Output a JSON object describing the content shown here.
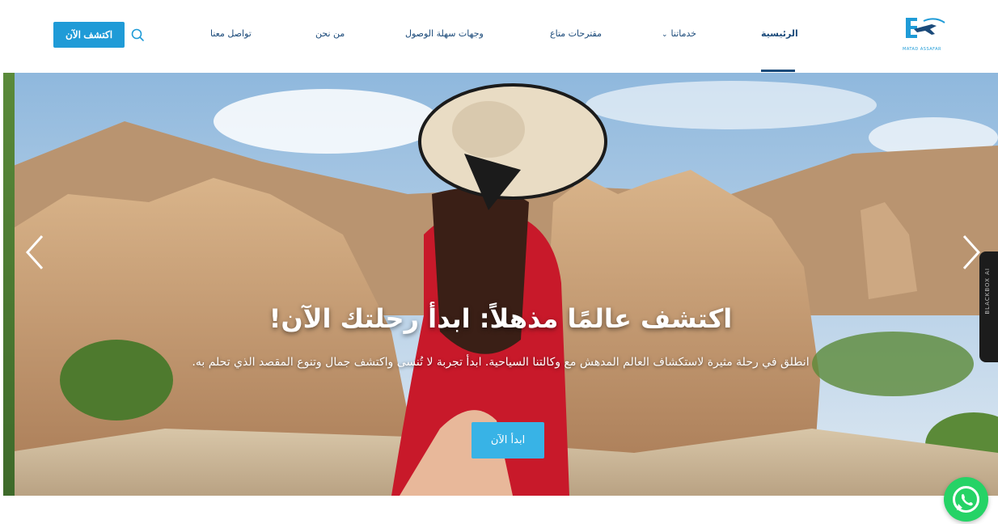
{
  "header": {
    "cta_label": "اكتشف الآن",
    "logo_text": "MATAD ASSAFAR",
    "nav": [
      {
        "label": "تواصل معنا"
      },
      {
        "label": "من نحن"
      },
      {
        "label": "وجهات سهلة الوصول"
      },
      {
        "label": "مقترحات متاع"
      },
      {
        "label": "خدماتنا"
      },
      {
        "label": "الرئيسية"
      }
    ]
  },
  "hero": {
    "title": "اكتشف عالمًا مذهلاً: ابدأ رحلتك الآن!",
    "subtitle": "انطلق في رحلة مثيرة لاستكشاف العالم المدهش مع وكالتنا السياحية. ابدأ تجربة لا تُنسى واكتشف جمال وتنوع المقصد الذي تحلم به.",
    "button_label": "ابدأ الآن"
  },
  "side_widget": {
    "label": "BLACKBOX AI"
  },
  "colors": {
    "accent": "#1f9bd7",
    "nav_text": "#1b4a7a",
    "whatsapp": "#25d366"
  }
}
